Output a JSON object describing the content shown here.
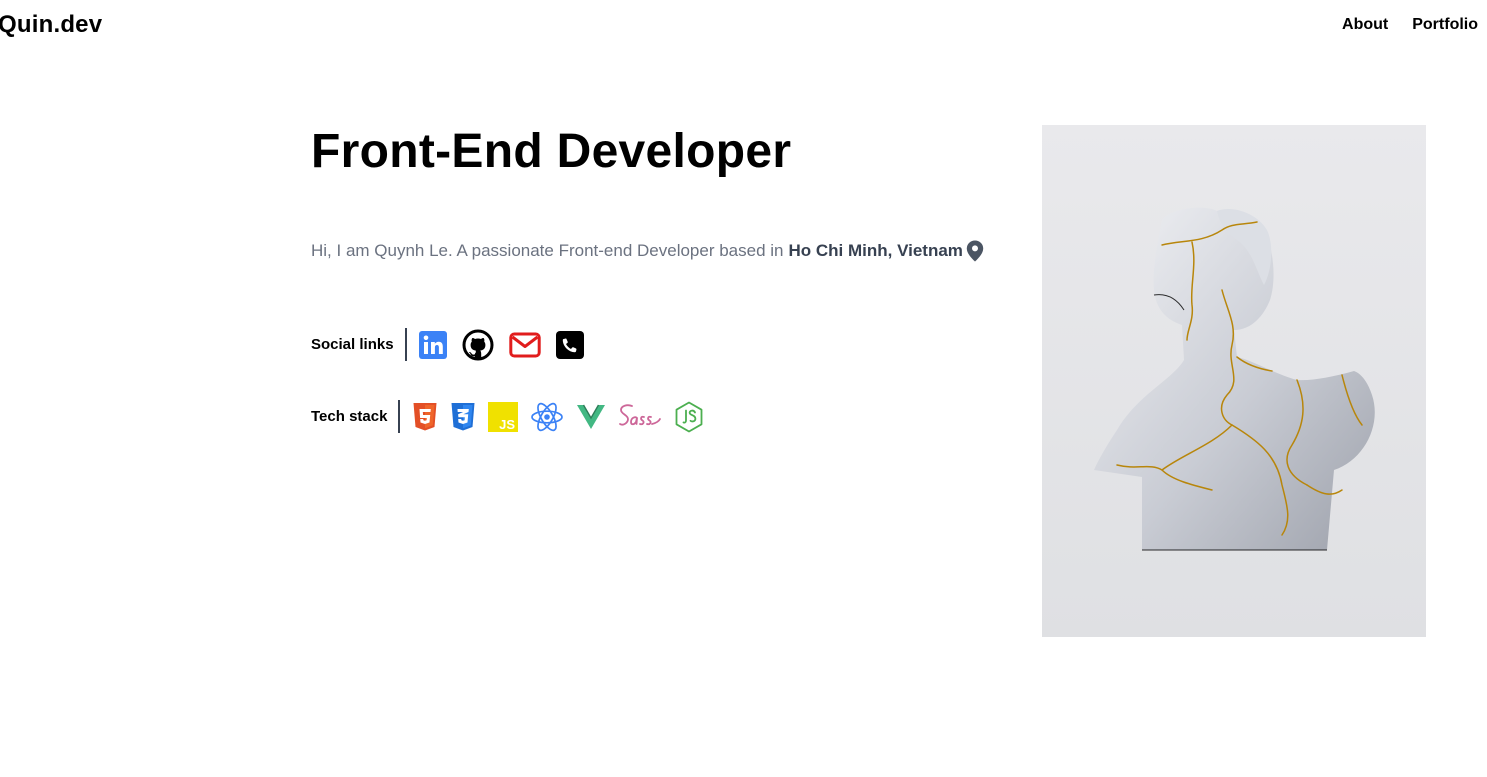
{
  "header": {
    "logo": "Quin.dev",
    "nav": [
      {
        "label": "About"
      },
      {
        "label": "Portfolio"
      }
    ]
  },
  "hero": {
    "title": "Front-End Developer",
    "intro_text": "Hi, I am Quynh Le. A passionate Front-end Developer based in",
    "location": "Ho Chi Minh, Vietnam"
  },
  "social": {
    "label": "Social links",
    "icons": [
      "linkedin-icon",
      "github-icon",
      "email-icon",
      "phone-icon"
    ]
  },
  "tech": {
    "label": "Tech stack",
    "icons": [
      "html5-icon",
      "css3-icon",
      "javascript-icon",
      "react-icon",
      "vue-icon",
      "sass-icon",
      "nodejs-icon"
    ],
    "js_badge": "JS"
  },
  "colors": {
    "linkedin": "#3b82f6",
    "email": "#e11d1d",
    "html5": "#e34f26",
    "css3": "#1f6fd6",
    "javascript": "#f0e100",
    "react": "#3b82f6",
    "vue": "#42b883",
    "sass": "#cd6799",
    "nodejs": "#4caf50"
  }
}
